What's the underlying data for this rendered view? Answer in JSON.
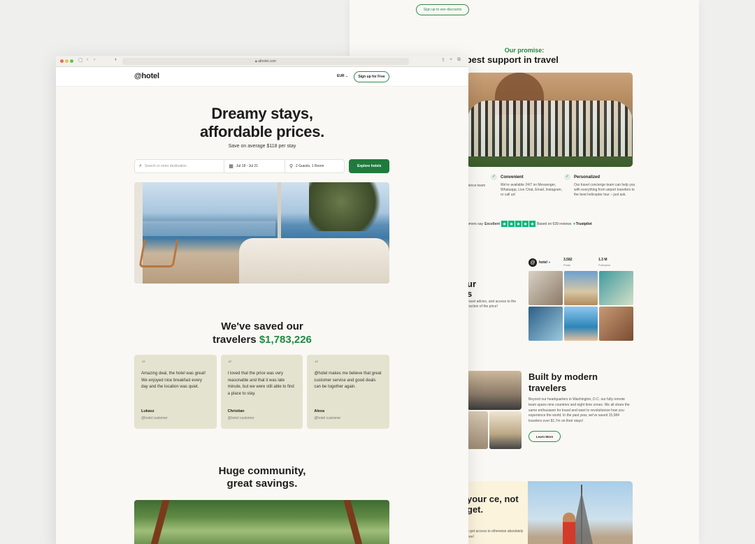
{
  "bg": {
    "top_button": "Sign up to see discounts",
    "promise_kicker": "Our promise:",
    "promise_title": "The best support in travel",
    "features": [
      {
        "title": "Convenient",
        "text": "We're available 24/7 on Messenger, Whatsapp, Live Chat, Email, Instagram, or call us!"
      },
      {
        "title": "Personalized",
        "text": "Our travel concierge team can help you with everything from airport transfers to the best helicopter tour – just ask."
      }
    ],
    "feature_left_fragment": "rience team",
    "trust": {
      "prefix": "omers say",
      "rating": "Excellent",
      "reviews": "Based on 639 reviews",
      "brand": "Trustpilot"
    },
    "insta": {
      "name": "hotel",
      "posts_value": "3,582",
      "posts_label": "Posts",
      "followers_value": "1.3 M",
      "followers_label": "Followers"
    },
    "insta_copy_title_1": "ur",
    "insta_copy_title_2": "s",
    "insta_copy": "travel advice, and access to the fraction of the price!",
    "built_title": "Built by modern travelers",
    "built_copy": "Beyond our headquarters in Washington, D.C. our fully remote team spans nine countries and eight time zones. We all share the same enthusiasm for travel and want to revolutionize how you experience the world. In the past year, we've saved 15,084 travelers over $1.7m on their stays!",
    "learn_more": "Learn More",
    "last_title": "your ce, not get.",
    "last_small": "o get access to otherwise absolutely free!"
  },
  "browser": {
    "url": "athotel.com",
    "logo": "@hotel",
    "currency": "EUR",
    "signup": "Sign up for Free"
  },
  "hero": {
    "title_line1": "Dreamy stays,",
    "title_line2": "affordable prices.",
    "subtitle": "Save on average $118 per stay"
  },
  "search": {
    "placeholder": "Search or enter destination",
    "dates": "Jul 18 - Jul 21",
    "guests": "2 Guests, 1 Room",
    "button": "Explore hotels"
  },
  "saved": {
    "line1": "We've saved our",
    "line2_prefix": "travelers",
    "amount": "$1,783,226"
  },
  "testimonials": [
    {
      "quote": "Amazing deal, the hotel was great! We enjoyed nice breakfast every day and the location was quiet.",
      "name": "Lukasz",
      "role": "@hotel customer"
    },
    {
      "quote": "I loved that the price was very reasonable and that it was late minute, but we were still able to find a place to stay.",
      "name": "Christian",
      "role": "@hotel customer"
    },
    {
      "quote": "@hotel makes me believe that great customer service and good deals can be together again.",
      "name": "Alexa",
      "role": "@hotel customer"
    }
  ],
  "community": {
    "line1": "Huge community,",
    "line2": "great savings."
  },
  "colors": {
    "accent": "#1f8a42",
    "button": "#1f7a3d",
    "card": "#e4e3cf",
    "page": "#f9f8f4"
  }
}
